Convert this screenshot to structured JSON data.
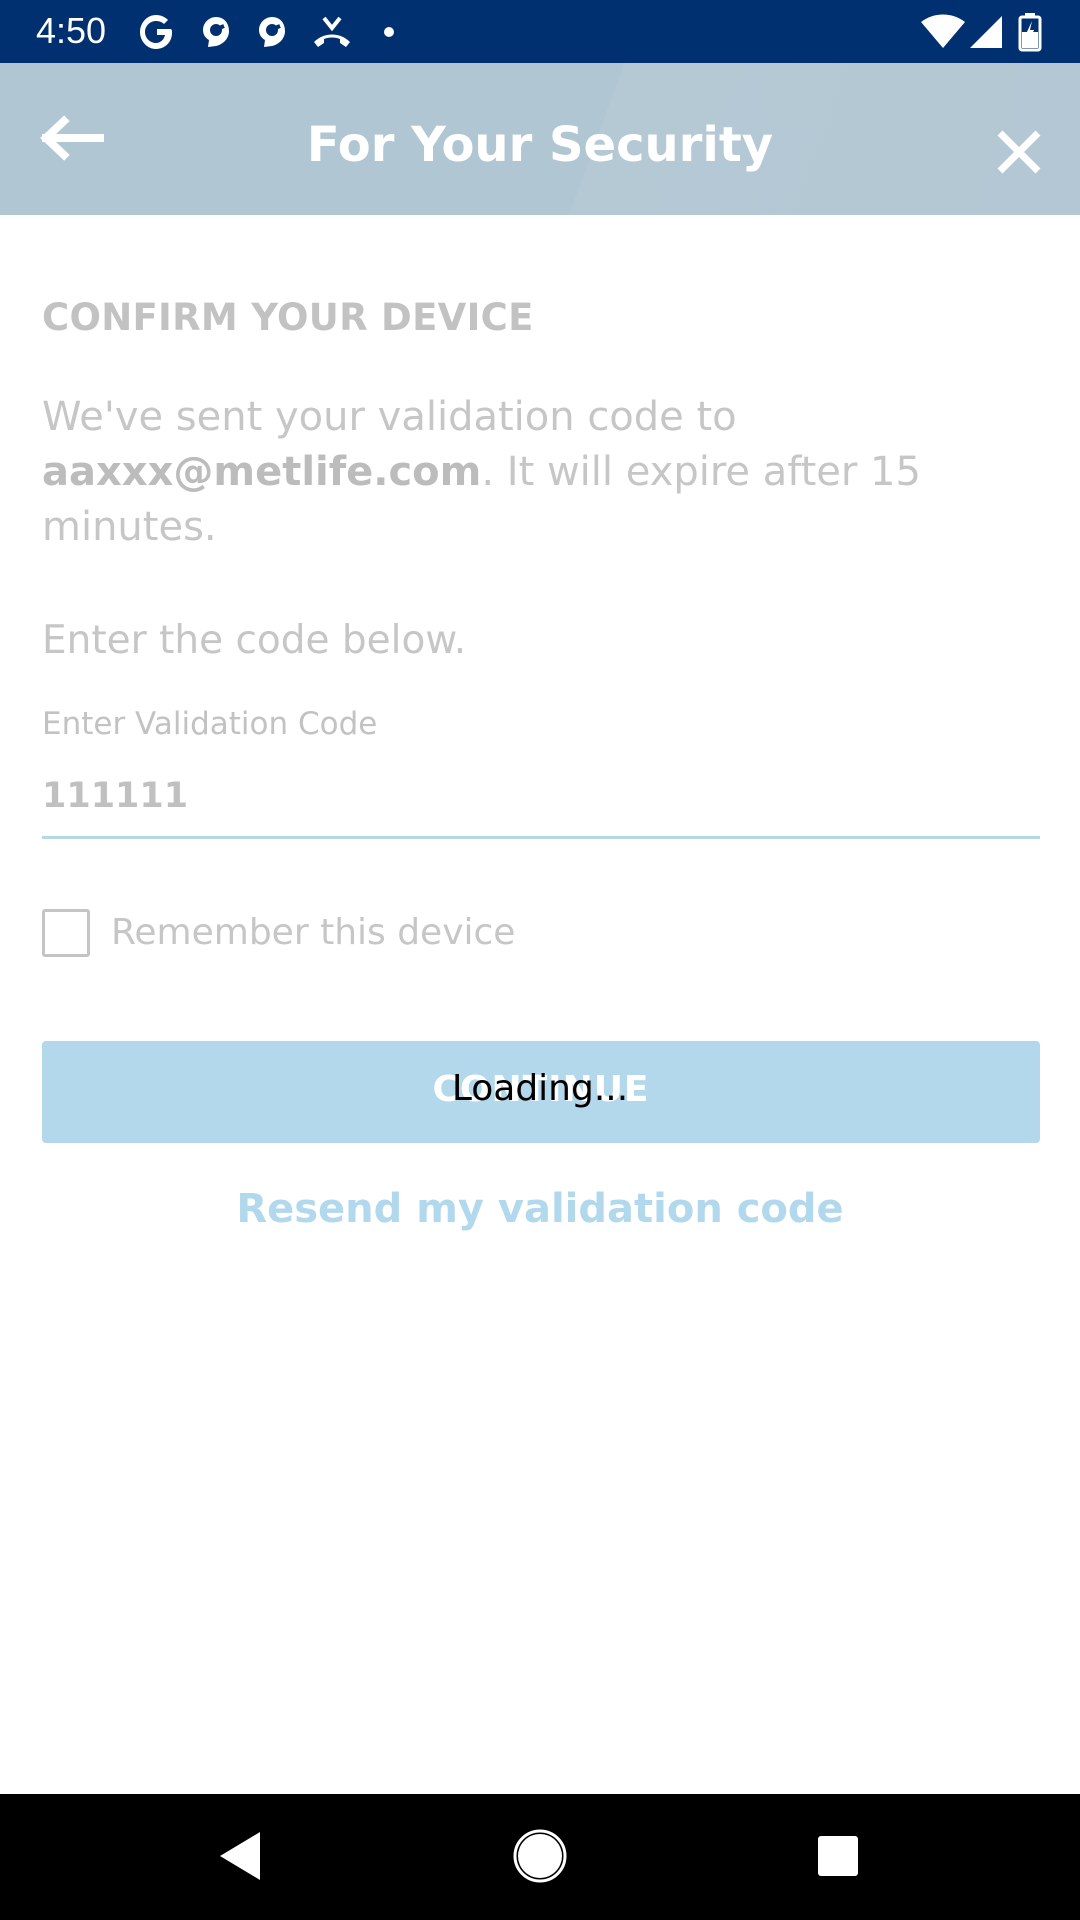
{
  "status_bar": {
    "time": "4:50",
    "left_icons": [
      "google-icon",
      "app-notification-icon",
      "app-notification-icon",
      "missed-call-icon",
      "dot-icon"
    ],
    "right_icons": [
      "wifi-icon",
      "signal-icon",
      "battery-icon"
    ]
  },
  "app_bar": {
    "title": "For Your Security",
    "back_icon": "arrow-left-icon",
    "close_icon": "close-icon"
  },
  "content": {
    "heading": "CONFIRM YOUR DEVICE",
    "intro_prefix": "We've sent your validation code to ",
    "intro_email": "aaxxx@metlife.com",
    "intro_suffix": ". It will expire after 15 minutes.",
    "instruction": "Enter the code below.",
    "code_field": {
      "label": "Enter Validation Code",
      "value": "111111"
    },
    "remember_device": {
      "label": "Remember this device",
      "checked": false
    },
    "continue_label": "CONTINUE",
    "loading_text": "Loading...",
    "resend_link": "Resend my validation code"
  },
  "nav_bar": {
    "icons": [
      "back-triangle-icon",
      "home-circle-icon",
      "recents-square-icon"
    ]
  },
  "colors": {
    "status_bar": "#003070",
    "app_bar": "#b1c6d3",
    "button": "#b3d8eb",
    "link": "#b1d8ec"
  }
}
